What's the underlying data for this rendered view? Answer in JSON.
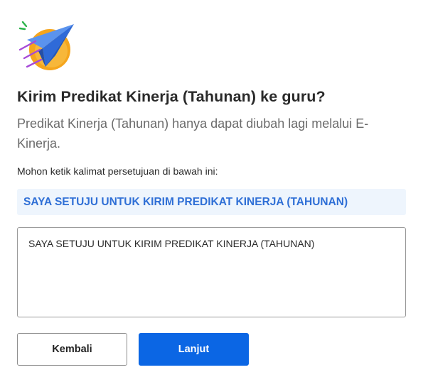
{
  "dialog": {
    "title": "Kirim Predikat Kinerja (Tahunan) ke guru?",
    "description": "Predikat Kinerja (Tahunan) hanya dapat diubah lagi melalui E-Kinerja.",
    "instruction": "Mohon ketik kalimat persetujuan di bawah ini:",
    "agreement_phrase": "SAYA SETUJU UNTUK KIRIM PREDIKAT KINERJA (TAHUNAN)",
    "input_value": "SAYA SETUJU UNTUK KIRIM PREDIKAT KINERJA (TAHUNAN)",
    "illustration_icon": "paper-plane-icon"
  },
  "buttons": {
    "back_label": "Kembali",
    "next_label": "Lanjut"
  },
  "colors": {
    "primary": "#0b66e4",
    "agreement_bg": "#eef5fd",
    "agreement_text": "#2f6fd6",
    "plane_blue": "#3f7fe6",
    "sun_orange": "#f5a51c"
  }
}
